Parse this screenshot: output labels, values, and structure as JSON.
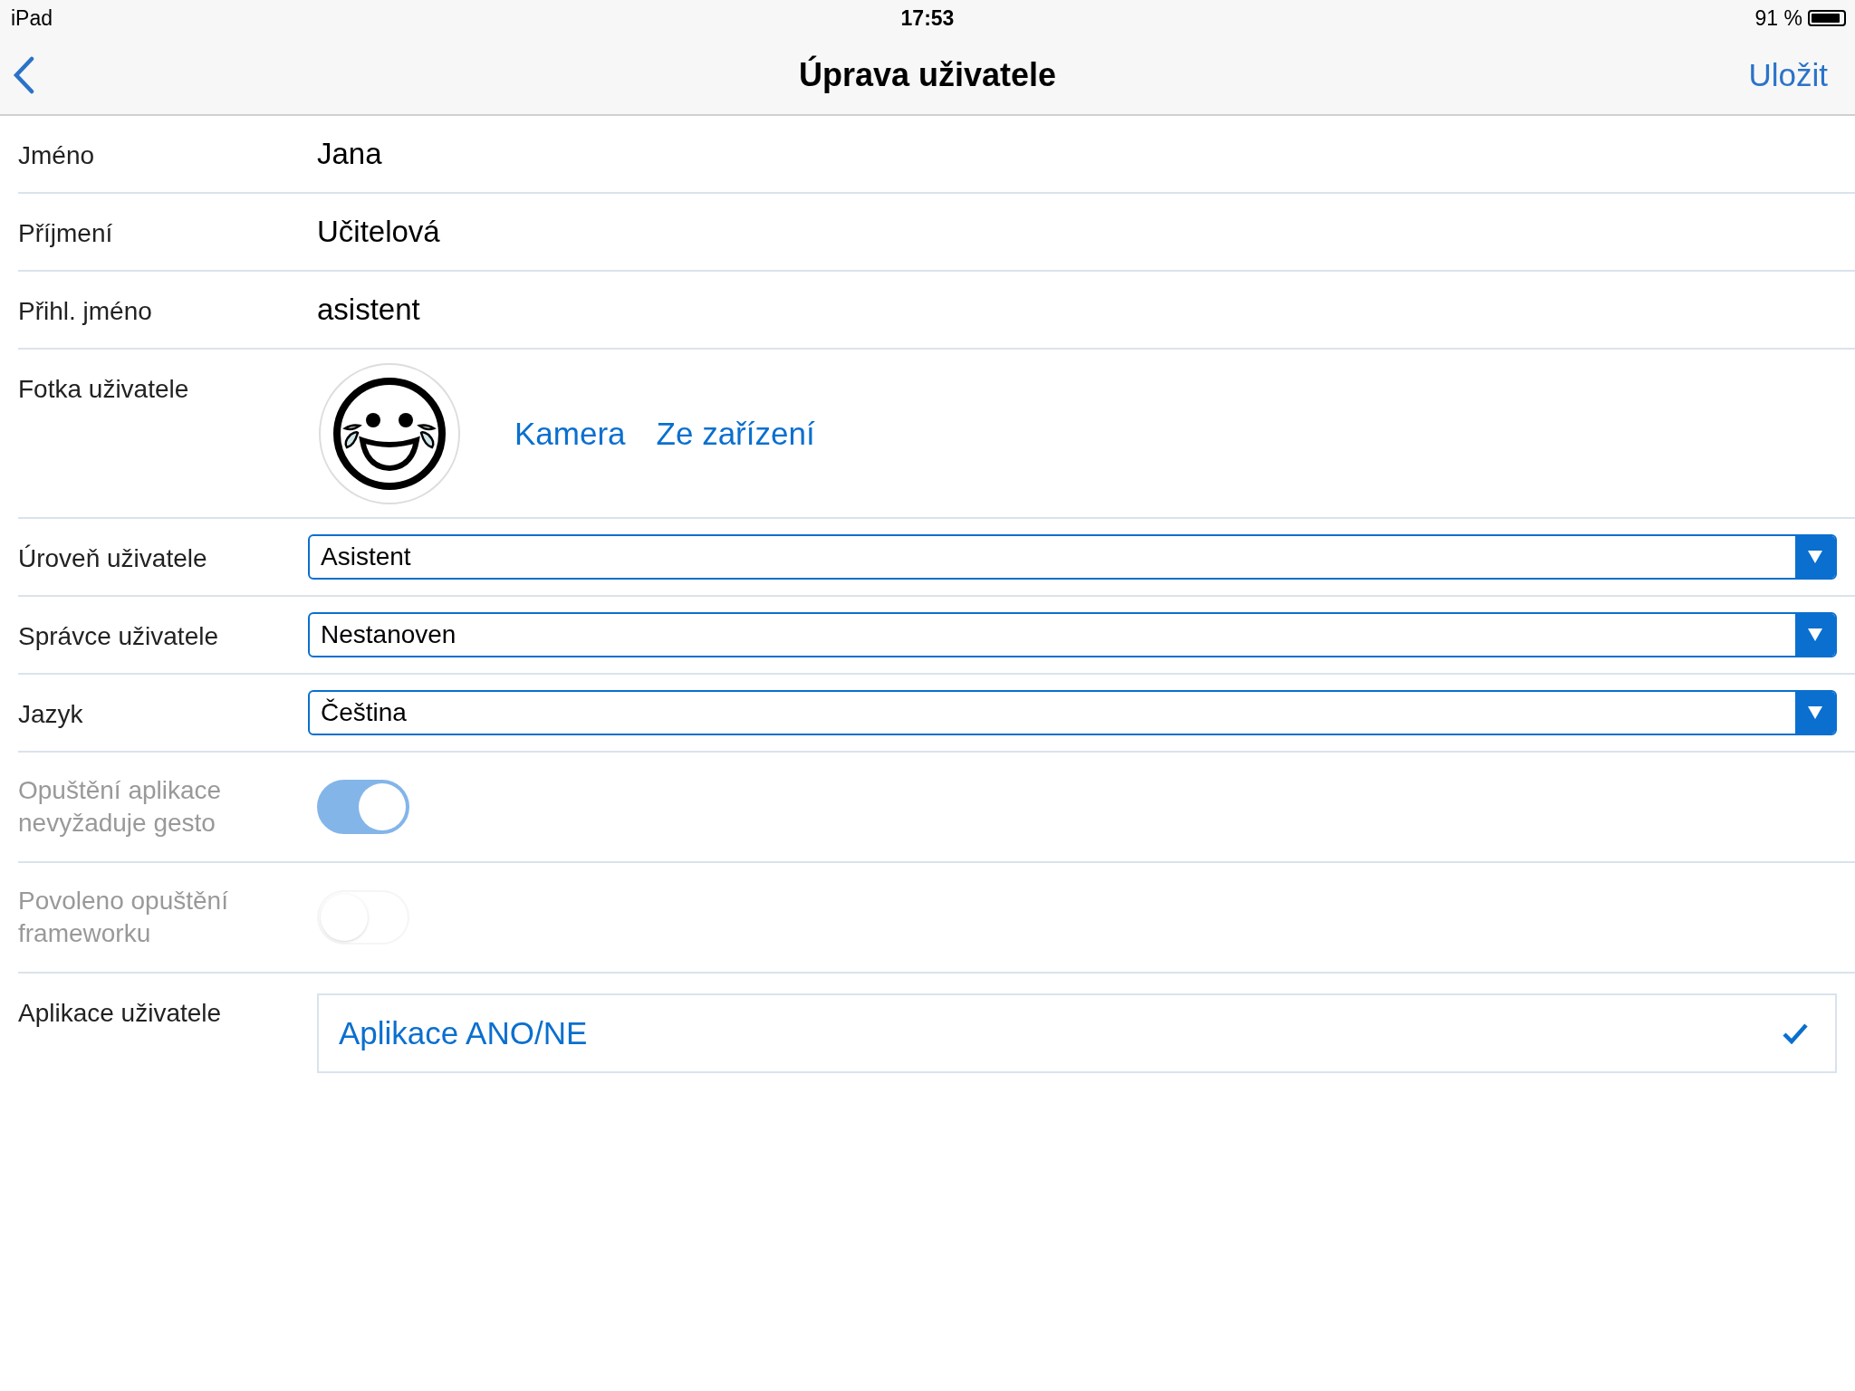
{
  "status_bar": {
    "device": "iPad",
    "time": "17:53",
    "battery": "91 %"
  },
  "nav": {
    "title": "Úprava uživatele",
    "save": "Uložit"
  },
  "rows": [
    {
      "kind": "text",
      "label": "Jméno",
      "value": "Jana"
    },
    {
      "kind": "text",
      "label": "Příjmení",
      "value": "Učitelová"
    },
    {
      "kind": "text",
      "label": "Přihl. jméno",
      "value": "asistent"
    },
    {
      "kind": "photo",
      "label": "Fotka uživatele",
      "actions": [
        "Kamera",
        "Ze zařízení"
      ]
    },
    {
      "kind": "select",
      "label": "Úroveň uživatele",
      "value": "Asistent"
    },
    {
      "kind": "select",
      "label": "Správce uživatele",
      "value": "Nestanoven"
    },
    {
      "kind": "select",
      "label": "Jazyk",
      "value": "Čeština"
    },
    {
      "kind": "toggle",
      "label": "Opuštění aplikace nevyžaduje gesto",
      "on": true,
      "disabled": true
    },
    {
      "kind": "toggle",
      "label": "Povoleno opuštění frameworku",
      "on": false,
      "disabled": true
    },
    {
      "kind": "apps",
      "label": "Aplikace uživatele",
      "apps": [
        {
          "name": "Aplikace ANO/NE",
          "checked": true
        }
      ]
    }
  ]
}
